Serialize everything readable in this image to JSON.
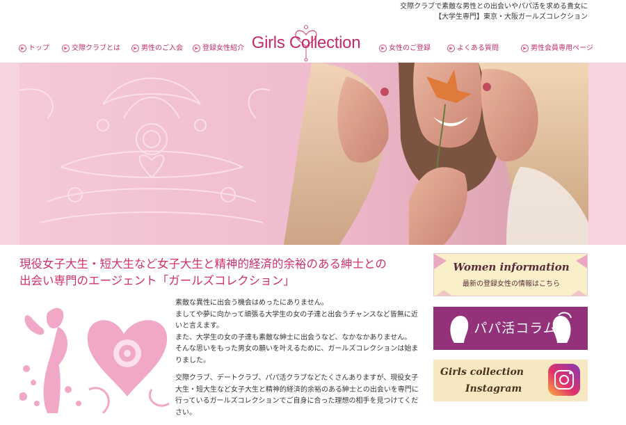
{
  "header": {
    "tagline_line1": "交際クラブで素敵な男性との出会いやパパ活を求める貴女に",
    "tagline_line2": "【大学生専門】東京・大阪ガールズコレクション",
    "logo_text": "Girls Collection"
  },
  "nav": {
    "left": [
      {
        "label": "トップ"
      },
      {
        "label": "交際クラブとは"
      },
      {
        "label": "男性のご入会"
      },
      {
        "label": "登録女性紹介"
      }
    ],
    "right": [
      {
        "label": "女性のご登録"
      },
      {
        "label": "よくある質問"
      },
      {
        "label": "男性会員専用ページ"
      }
    ]
  },
  "main": {
    "heading_line1": "現役女子大生・短大生など女子大生と精神的経済的余裕のある紳士との",
    "heading_line2": "出会い専門のエージェント「ガールズコレクション」",
    "paragraph1": "素敵な異性に出会う機会はめったにありません。\nましてや夢に向かって頑張る大学生の女の子達と出会うチャンスなど皆無に近いと言えます。\nまた、大学生の女の子達も素敵な紳士に出会うなど、なかなかありません。\nそんな思いをもった男女の願いを叶えるために、ガールズコレクションは始まりました。",
    "paragraph2": "交際クラブ、デートクラブ、パパ活クラブなどたくさんありますが、現役女子大生・短大生など女子大生と精神的経済的余裕のある紳士との出会いを専門に行っているガールズコレクションでご自身に合った理想の相手を見つけてください。"
  },
  "sidebar": {
    "banner1_title": "Women information",
    "banner1_sub": "最新の登録女性の情報はこちら",
    "banner2_title": "パパ活コラム",
    "banner3_title_line1": "Girls collection",
    "banner3_title_line2": "Instagram"
  },
  "colors": {
    "accent": "#d1306e",
    "nav_text": "#c0306a",
    "hero_pink": "#f3c4d6",
    "column_purple": "#93327a"
  }
}
